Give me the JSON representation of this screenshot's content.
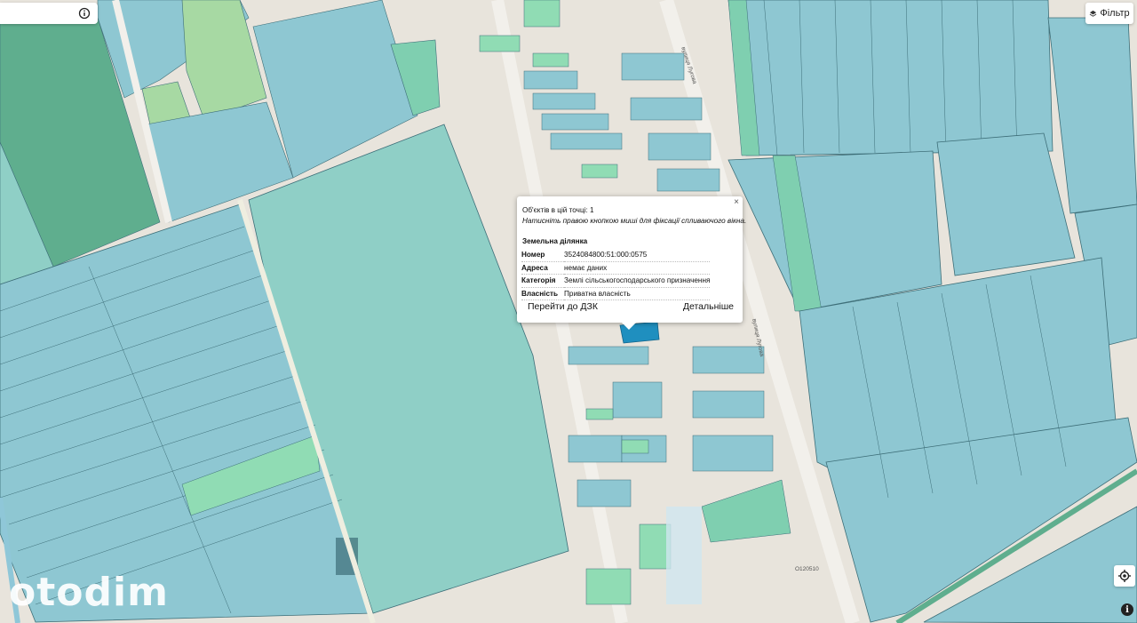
{
  "search": {
    "placeholder": ""
  },
  "filter": {
    "label": "Фільтр"
  },
  "popup": {
    "count_text": "Об'єктів в цій точці: 1",
    "hint": "Натисніть правою кнопкою миші для фіксації спливаючого вікна.",
    "section": "Земельна ділянка",
    "rows": [
      {
        "key": "Номер",
        "value": "3524084800:51:000:0575"
      },
      {
        "key": "Адреса",
        "value": "немає даних"
      },
      {
        "key": "Категорія",
        "value": "Землі сільськогосподарського призначення"
      },
      {
        "key": "Власність",
        "value": "Приватна власність"
      }
    ],
    "left_button": "Перейти до ДЗК",
    "right_button": "Детальніше",
    "close": "×"
  },
  "map_labels": {
    "street_top": "вулиця Лугова",
    "street_mid": "вулиця Лугова",
    "road_code": "О120510"
  },
  "logo": "otodim",
  "colors": {
    "background": "#e8e4dc",
    "parcel_blue": "#8ec7d2",
    "parcel_teal": "#8fcfc6",
    "parcel_green": "#7fcfb0",
    "parcel_dark_green": "#5fae8e",
    "parcel_light_green": "#a7d9a3",
    "parcel_selected": "#1f8fbf",
    "road": "#f2f0eb",
    "parcel_border": "#3d6e78"
  },
  "icons": {
    "info": "info-circle-icon",
    "filter": "layers-icon",
    "locate": "locate-icon",
    "attribution": "info-icon"
  }
}
